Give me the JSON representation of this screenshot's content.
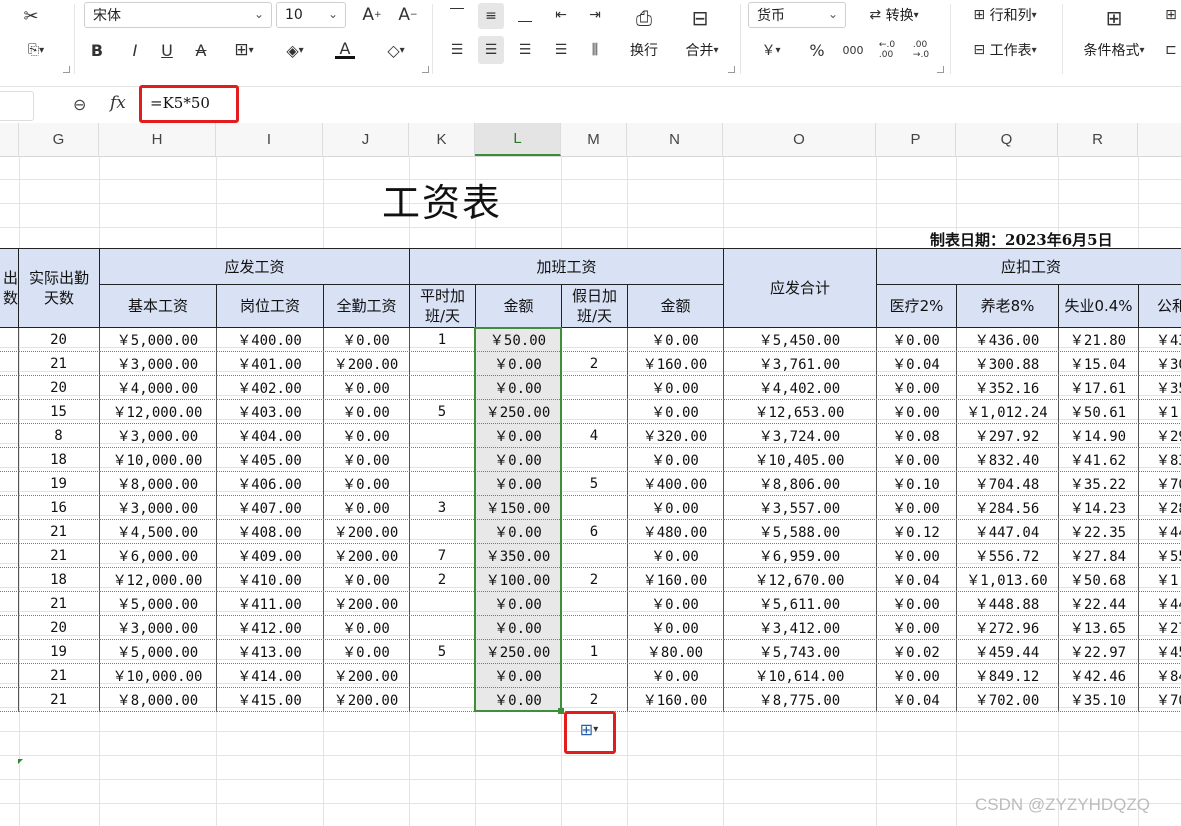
{
  "ribbon": {
    "font_name": "宋体",
    "font_size": "10",
    "number_format": "货币",
    "wrap_label": "换行",
    "merge_label": "合并",
    "convert_label": "转换",
    "rowcol_label": "行和列",
    "worksheet_label": "工作表",
    "conditional_label": "条件格式",
    "currency_symbol": "￥",
    "percent_symbol": "%",
    "thousands_symbol": "000",
    "inc_decimal_symbol": "←.0\n.00",
    "dec_decimal_symbol": ".00\n→.0"
  },
  "formula": {
    "content": "=K5*50"
  },
  "columns": [
    {
      "id": "G",
      "label": "G"
    },
    {
      "id": "H",
      "label": "H"
    },
    {
      "id": "I",
      "label": "I"
    },
    {
      "id": "J",
      "label": "J"
    },
    {
      "id": "K",
      "label": "K"
    },
    {
      "id": "L",
      "label": "L"
    },
    {
      "id": "M",
      "label": "M"
    },
    {
      "id": "N",
      "label": "N"
    },
    {
      "id": "O",
      "label": "O"
    },
    {
      "id": "P",
      "label": "P"
    },
    {
      "id": "Q",
      "label": "Q"
    },
    {
      "id": "R",
      "label": "R"
    }
  ],
  "sheet": {
    "title": "工资表",
    "date": "制表日期：2023年6月5日",
    "headers": {
      "partial_left": "出\n数",
      "actual_days": "实际出勤\n天数",
      "payable": "应发工资",
      "base": "基本工资",
      "post": "岗位工资",
      "attendance": "全勤工资",
      "overtime": "加班工资",
      "ot_days": "平时加\n班/天",
      "ot_amount": "金额",
      "hol_days": "假日加\n班/天",
      "hol_amount": "金额",
      "total": "应发合计",
      "deduction": "应扣工资",
      "medical": "医疗2%",
      "pension": "养老8%",
      "unemployment": "失业0.4%",
      "fund_partial": "公和"
    },
    "rows": [
      [
        "20",
        "￥5,000.00",
        "￥400.00",
        "￥0.00",
        "1",
        "￥50.00",
        "",
        "￥0.00",
        "￥5,450.00",
        "￥0.00",
        "￥436.00",
        "￥21.80",
        "￥43"
      ],
      [
        "21",
        "￥3,000.00",
        "￥401.00",
        "￥200.00",
        "",
        "￥0.00",
        "2",
        "￥160.00",
        "￥3,761.00",
        "￥0.04",
        "￥300.88",
        "￥15.04",
        "￥30"
      ],
      [
        "20",
        "￥4,000.00",
        "￥402.00",
        "￥0.00",
        "",
        "￥0.00",
        "",
        "￥0.00",
        "￥4,402.00",
        "￥0.00",
        "￥352.16",
        "￥17.61",
        "￥35"
      ],
      [
        "15",
        "￥12,000.00",
        "￥403.00",
        "￥0.00",
        "5",
        "￥250.00",
        "",
        "￥0.00",
        "￥12,653.00",
        "￥0.00",
        "￥1,012.24",
        "￥50.61",
        "￥1,0"
      ],
      [
        "8",
        "￥3,000.00",
        "￥404.00",
        "￥0.00",
        "",
        "￥0.00",
        "4",
        "￥320.00",
        "￥3,724.00",
        "￥0.08",
        "￥297.92",
        "￥14.90",
        "￥29"
      ],
      [
        "18",
        "￥10,000.00",
        "￥405.00",
        "￥0.00",
        "",
        "￥0.00",
        "",
        "￥0.00",
        "￥10,405.00",
        "￥0.00",
        "￥832.40",
        "￥41.62",
        "￥83"
      ],
      [
        "19",
        "￥8,000.00",
        "￥406.00",
        "￥0.00",
        "",
        "￥0.00",
        "5",
        "￥400.00",
        "￥8,806.00",
        "￥0.10",
        "￥704.48",
        "￥35.22",
        "￥70"
      ],
      [
        "16",
        "￥3,000.00",
        "￥407.00",
        "￥0.00",
        "3",
        "￥150.00",
        "",
        "￥0.00",
        "￥3,557.00",
        "￥0.00",
        "￥284.56",
        "￥14.23",
        "￥28"
      ],
      [
        "21",
        "￥4,500.00",
        "￥408.00",
        "￥200.00",
        "",
        "￥0.00",
        "6",
        "￥480.00",
        "￥5,588.00",
        "￥0.12",
        "￥447.04",
        "￥22.35",
        "￥44"
      ],
      [
        "21",
        "￥6,000.00",
        "￥409.00",
        "￥200.00",
        "7",
        "￥350.00",
        "",
        "￥0.00",
        "￥6,959.00",
        "￥0.00",
        "￥556.72",
        "￥27.84",
        "￥55"
      ],
      [
        "18",
        "￥12,000.00",
        "￥410.00",
        "￥0.00",
        "2",
        "￥100.00",
        "2",
        "￥160.00",
        "￥12,670.00",
        "￥0.04",
        "￥1,013.60",
        "￥50.68",
        "￥1,0"
      ],
      [
        "21",
        "￥5,000.00",
        "￥411.00",
        "￥200.00",
        "",
        "￥0.00",
        "",
        "￥0.00",
        "￥5,611.00",
        "￥0.00",
        "￥448.88",
        "￥22.44",
        "￥44"
      ],
      [
        "20",
        "￥3,000.00",
        "￥412.00",
        "￥0.00",
        "",
        "￥0.00",
        "",
        "￥0.00",
        "￥3,412.00",
        "￥0.00",
        "￥272.96",
        "￥13.65",
        "￥27"
      ],
      [
        "19",
        "￥5,000.00",
        "￥413.00",
        "￥0.00",
        "5",
        "￥250.00",
        "1",
        "￥80.00",
        "￥5,743.00",
        "￥0.02",
        "￥459.44",
        "￥22.97",
        "￥45"
      ],
      [
        "21",
        "￥10,000.00",
        "￥414.00",
        "￥200.00",
        "",
        "￥0.00",
        "",
        "￥0.00",
        "￥10,614.00",
        "￥0.00",
        "￥849.12",
        "￥42.46",
        "￥84"
      ],
      [
        "21",
        "￥8,000.00",
        "￥415.00",
        "￥200.00",
        "",
        "￥0.00",
        "2",
        "￥160.00",
        "￥8,775.00",
        "￥0.04",
        "￥702.00",
        "￥35.10",
        "￥70"
      ]
    ]
  },
  "watermark": "CSDN @ZYZYHDQZQ"
}
